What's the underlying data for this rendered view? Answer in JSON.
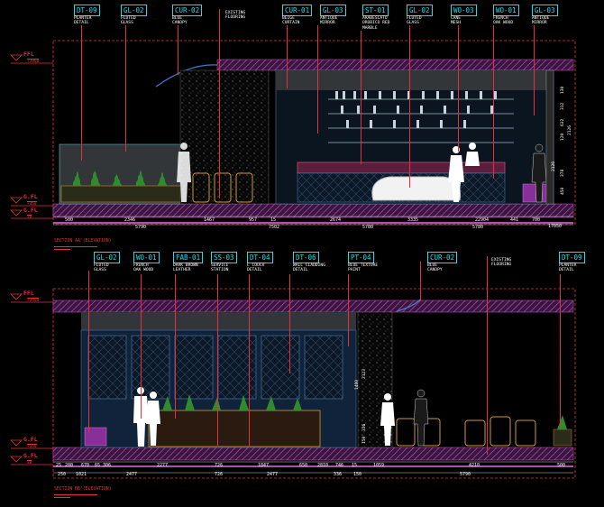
{
  "elevation_a": {
    "tags": [
      {
        "code": "DT-09",
        "desc": "PLANTER\nDETAIL"
      },
      {
        "code": "GL-02",
        "desc": "FLUTED\nGLASS"
      },
      {
        "code": "CUR-02",
        "desc": "BLUE\nCANOPY"
      },
      {
        "code": "",
        "desc": "EXISTING\nFLOORING"
      },
      {
        "code": "CUR-01",
        "desc": "BEIGE\nCURTAIN"
      },
      {
        "code": "GL-03",
        "desc": "ANTIQUE\nMIRROR"
      },
      {
        "code": "ST-01",
        "desc": "ARABESCATO\nOROBICO RED\nMARBLE"
      },
      {
        "code": "GL-02",
        "desc": "FLUTED\nGLASS"
      },
      {
        "code": "WO-03",
        "desc": "CANE\nMESH"
      },
      {
        "code": "WO-01",
        "desc": "FRENCH\nOAK WOOD"
      },
      {
        "code": "GL-03",
        "desc": "ANTIQUE\nMIRROR"
      }
    ],
    "levels": [
      {
        "label": "FFL",
        "sub": "+3900"
      },
      {
        "label": "G.FL",
        "sub": "+350"
      },
      {
        "label": "G.FL",
        "sub": "±0"
      }
    ],
    "dims_row1": [
      "500",
      "2346",
      "1467",
      "957",
      "2674",
      "3335",
      "441",
      "700"
    ],
    "dims_row1_extra": [
      "15",
      "22904",
      "17050"
    ],
    "dims_row2": [
      "5790",
      "7502",
      "5780",
      "5780"
    ],
    "vdims": [
      "130",
      "312",
      "632",
      "120",
      "2126",
      "2126",
      "378",
      "450"
    ],
    "caption": "SECTION AA'(ELEVATION)"
  },
  "elevation_b": {
    "tags": [
      {
        "code": "GL-02",
        "desc": "FLUTED\nGLASS"
      },
      {
        "code": "WO-01",
        "desc": "FRENCH\nOAK WOOD"
      },
      {
        "code": "FAB-01",
        "desc": "DARK BROWN\nLEATHER"
      },
      {
        "code": "SS-03",
        "desc": "SERVICE\nSTATION"
      },
      {
        "code": "DT-04",
        "desc": "L COUCH\nDETAIL"
      },
      {
        "code": "DT-06",
        "desc": "WALL CLADDING\nDETAIL"
      },
      {
        "code": "PT-04",
        "desc": "BLUE TEXTURE\nPAINT"
      },
      {
        "code": "CUR-02",
        "desc": "BLUE\nCANOPY"
      },
      {
        "code": "",
        "desc": "EXISTING\nFLOORING"
      },
      {
        "code": "DT-09",
        "desc": "PLANTER\nDETAIL"
      }
    ],
    "levels": [
      {
        "label": "FFL",
        "sub": "+3900"
      },
      {
        "label": "G.FL",
        "sub": "+350"
      },
      {
        "label": "G.FL",
        "sub": "±0"
      }
    ],
    "dims_row1": [
      "25",
      "200",
      "670",
      "65",
      "306",
      "2277",
      "726",
      "1847",
      "650",
      "2810",
      "746",
      "15",
      "1059",
      "4210",
      "500"
    ],
    "dims_row2": [
      "250",
      "1021",
      "2477",
      "726",
      "2477",
      "336",
      "150",
      "5790"
    ],
    "vdims": [
      "2123",
      "1480",
      "336",
      "150"
    ],
    "caption": "SECTION BB'(ELEVATION)"
  },
  "colors": {
    "background": "#000000",
    "tag": "#19e0e6",
    "leader": "#e5313b",
    "hatch": "#8a3a8c",
    "wall": "#1e2d4a",
    "dim": "#ffffff"
  }
}
